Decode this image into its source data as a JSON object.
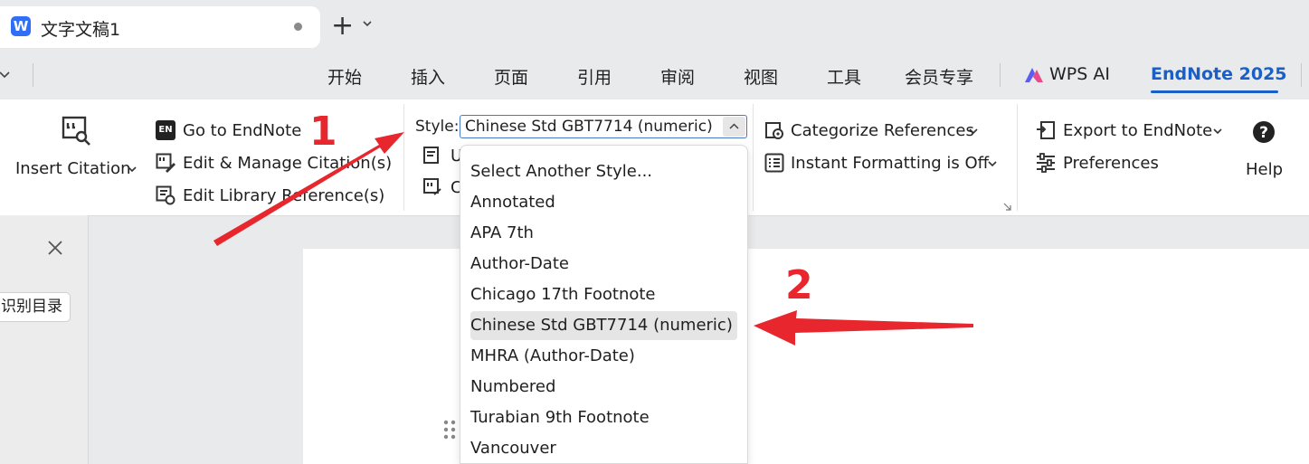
{
  "window": {
    "doc_tab_title": "文字文稿1",
    "app_logo": "W",
    "new_tab_label": "+"
  },
  "menu": {
    "tabs": [
      "开始",
      "插入",
      "页面",
      "引用",
      "审阅",
      "视图",
      "工具",
      "会员专享"
    ],
    "wps_ai": "WPS AI",
    "endnote": "EndNote 2025"
  },
  "ribbon": {
    "insert_citation": "Insert Citation",
    "go_to_endnote": "Go to EndNote",
    "edit_manage": "Edit & Manage Citation(s)",
    "edit_library": "Edit Library Reference(s)",
    "style_label": "Style:",
    "style_value": "Chinese Std GBT7714 (numeric)",
    "hidden_item_1": "U",
    "hidden_item_2": "C",
    "categorize": "Categorize References",
    "instant_formatting": "Instant Formatting is Off",
    "export": "Export to EndNote",
    "preferences": "Preferences",
    "help": "Help",
    "en_badge": "EN"
  },
  "dropdown": {
    "items": [
      "Select Another Style...",
      "Annotated",
      "APA 7th",
      "Author-Date",
      "Chicago 17th Footnote",
      "Chinese Std GBT7714 (numeric)",
      "MHRA (Author-Date)",
      "Numbered",
      "Turabian 9th Footnote",
      "Vancouver"
    ],
    "selected_index": 5
  },
  "nav_panel": {
    "toc_button": "识别目录"
  },
  "annotations": {
    "step1": "1",
    "step2": "2",
    "color": "#e8262e"
  },
  "icons": [
    "app-logo-icon",
    "close-dot-icon",
    "plus-icon",
    "chevron-down-icon",
    "insert-citation-icon",
    "endnote-badge-icon",
    "edit-citation-icon",
    "edit-library-icon",
    "categorize-icon",
    "instant-formatting-icon",
    "export-icon",
    "preferences-icon",
    "help-icon",
    "close-icon",
    "drag-handle-icon"
  ]
}
